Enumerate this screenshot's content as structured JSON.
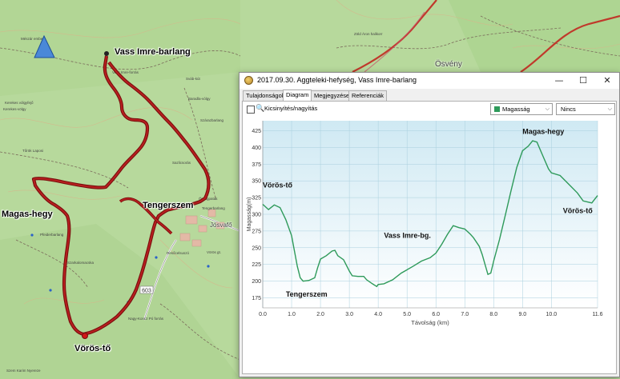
{
  "map": {
    "track_color": "#9b1b1b",
    "labels": {
      "vass_imre": "Vass Imre-barlang",
      "tengerszem": "Tengerszem",
      "magas_hegy": "Magas-hegy",
      "voros_to": "Vörös-tő",
      "osveny": "Ösvény",
      "jósvafo": "Jósvafő",
      "road_number": "603"
    }
  },
  "window": {
    "title": "2017.09.30. Aggteleki-hefység, Vass Imre-barlang",
    "buttons": {
      "minimize": "—",
      "maximize": "☐",
      "close": "✕"
    },
    "tabs": [
      "Tulajdonságok",
      "Diagram",
      "Megjegyzések",
      "Referenciák"
    ],
    "active_tab": "Diagram",
    "zoom_label": "Kicsinyítés/nagyítás",
    "dropdown_series": "Magasság",
    "dropdown_second": "Nincs",
    "accent_color": "#2e9a5a"
  },
  "chart_data": {
    "type": "area",
    "xlabel": "Távolság  (km)",
    "ylabel": "Magasság(m)",
    "xlim": [
      0.0,
      11.6
    ],
    "ylim": [
      160,
      440
    ],
    "x_ticks": [
      "0.0",
      "1.0",
      "2.0",
      "3.0",
      "4.0",
      "5.0",
      "6.0",
      "7.0",
      "8.0",
      "9.0",
      "10.0",
      "11.6"
    ],
    "x_tick_values": [
      0,
      1,
      2,
      3,
      4,
      5,
      6,
      7,
      8,
      9,
      10,
      11.6
    ],
    "y_ticks": [
      175,
      200,
      225,
      250,
      275,
      300,
      325,
      350,
      375,
      400,
      425
    ],
    "grid": true,
    "series": [
      {
        "name": "Magasság",
        "color": "#2e9a5a",
        "points": [
          [
            0.0,
            315
          ],
          [
            0.2,
            307
          ],
          [
            0.4,
            314
          ],
          [
            0.6,
            310
          ],
          [
            0.8,
            292
          ],
          [
            1.0,
            268
          ],
          [
            1.1,
            245
          ],
          [
            1.2,
            222
          ],
          [
            1.3,
            205
          ],
          [
            1.4,
            200
          ],
          [
            1.6,
            201
          ],
          [
            1.8,
            205
          ],
          [
            1.9,
            220
          ],
          [
            2.0,
            233
          ],
          [
            2.2,
            238
          ],
          [
            2.4,
            245
          ],
          [
            2.5,
            246
          ],
          [
            2.6,
            238
          ],
          [
            2.8,
            232
          ],
          [
            3.0,
            215
          ],
          [
            3.1,
            208
          ],
          [
            3.3,
            207
          ],
          [
            3.5,
            207
          ],
          [
            3.6,
            202
          ],
          [
            3.8,
            196
          ],
          [
            3.95,
            192
          ],
          [
            4.0,
            195
          ],
          [
            4.2,
            196
          ],
          [
            4.5,
            202
          ],
          [
            4.8,
            212
          ],
          [
            5.2,
            222
          ],
          [
            5.5,
            230
          ],
          [
            5.8,
            235
          ],
          [
            6.0,
            242
          ],
          [
            6.2,
            255
          ],
          [
            6.4,
            270
          ],
          [
            6.6,
            283
          ],
          [
            6.8,
            280
          ],
          [
            7.0,
            278
          ],
          [
            7.2,
            270
          ],
          [
            7.3,
            265
          ],
          [
            7.5,
            252
          ],
          [
            7.6,
            240
          ],
          [
            7.7,
            225
          ],
          [
            7.8,
            210
          ],
          [
            7.9,
            212
          ],
          [
            8.0,
            230
          ],
          [
            8.2,
            262
          ],
          [
            8.4,
            298
          ],
          [
            8.6,
            335
          ],
          [
            8.8,
            370
          ],
          [
            9.0,
            395
          ],
          [
            9.2,
            402
          ],
          [
            9.35,
            410
          ],
          [
            9.5,
            408
          ],
          [
            9.7,
            388
          ],
          [
            9.9,
            368
          ],
          [
            10.0,
            362
          ],
          [
            10.3,
            358
          ],
          [
            10.6,
            345
          ],
          [
            10.9,
            332
          ],
          [
            11.1,
            320
          ],
          [
            11.4,
            317
          ],
          [
            11.6,
            328
          ]
        ]
      }
    ],
    "annotations": [
      {
        "text": "Vörös-tő",
        "x": 0.0,
        "y": 340
      },
      {
        "text": "Tengerszem",
        "x": 0.8,
        "y": 177
      },
      {
        "text": "Vass Imre-bg.",
        "x": 4.2,
        "y": 265
      },
      {
        "text": "Magas-hegy",
        "x": 9.0,
        "y": 420
      },
      {
        "text": "Vörös-tő",
        "x": 10.4,
        "y": 302
      }
    ]
  }
}
